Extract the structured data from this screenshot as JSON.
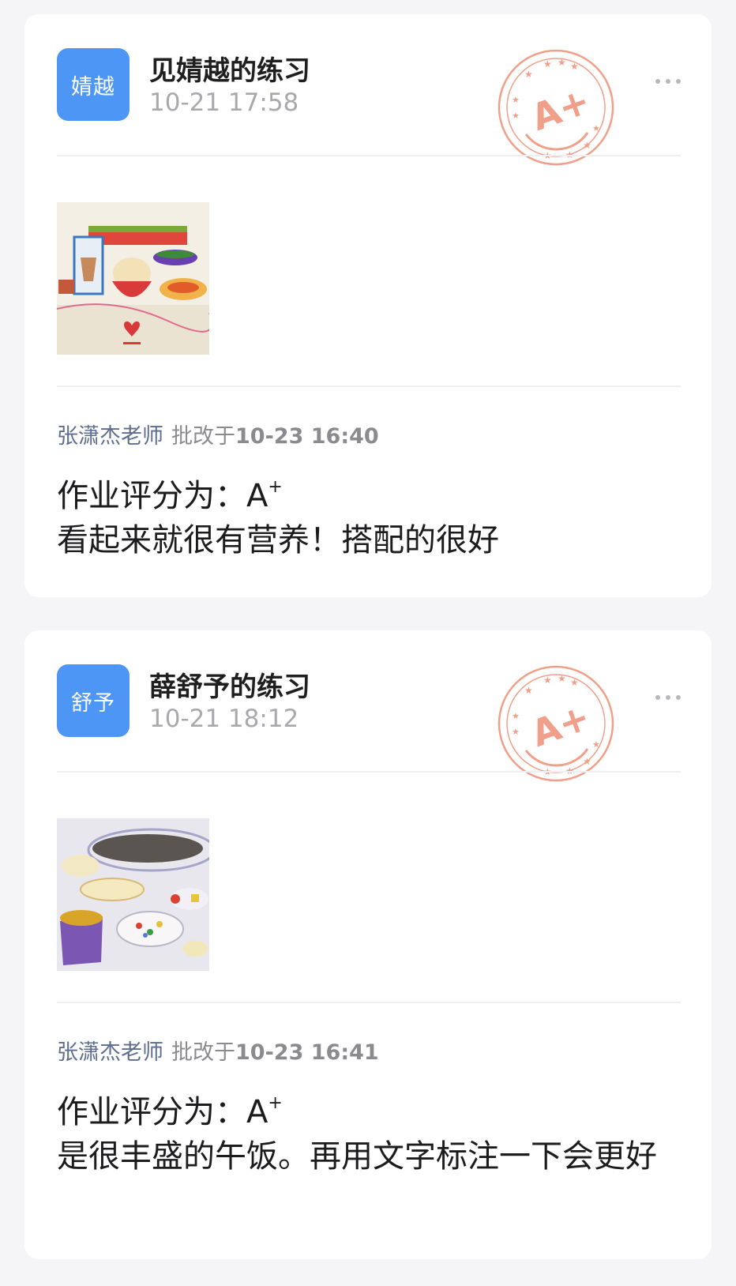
{
  "submissions": [
    {
      "avatar_text": "婧越",
      "title": "见婧越的练习",
      "time": "10-21 17:58",
      "stamp_grade": "A+",
      "reviewer": "张潇杰老师",
      "review_prefix": "批改于",
      "review_time": "10-23 16:40",
      "grade_label": "作业评分为：",
      "grade": "A",
      "grade_suffix": "+",
      "comment": "看起来就很有营养！搭配的很好"
    },
    {
      "avatar_text": "舒予",
      "title": "薛舒予的练习",
      "time": "10-21 18:12",
      "stamp_grade": "A+",
      "reviewer": "张潇杰老师",
      "review_prefix": "批改于",
      "review_time": "10-23 16:41",
      "grade_label": "作业评分为：",
      "grade": "A",
      "grade_suffix": "+",
      "comment": "是很丰盛的午饭。再用文字标注一下会更好"
    }
  ],
  "colors": {
    "avatar": "#4d96f6",
    "stamp": "#f0a08a",
    "reviewer": "#5d6d8f",
    "background": "#f5f5f7"
  },
  "icons": {
    "more": "more-dots-icon",
    "stamp": "grade-stamp-icon"
  }
}
